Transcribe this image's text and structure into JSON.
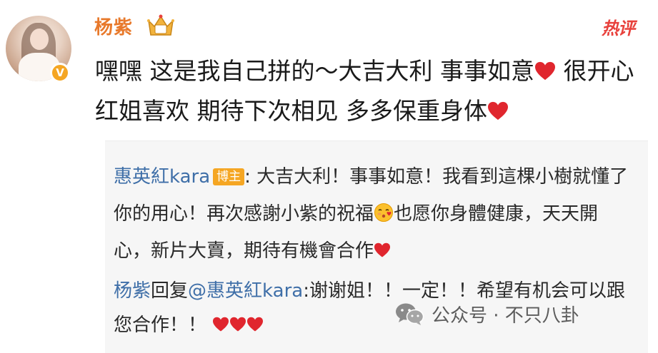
{
  "post": {
    "username": "杨紫",
    "hot_label": "热评",
    "content_parts": [
      "嘿嘿 这是我自己拼的～大吉大利 事事如意",
      " 很开心红姐喜欢 期待下次相见 多多保重身体"
    ]
  },
  "reply_author": {
    "name": "惠英紅kara",
    "badge": "博主",
    "text_part1": ": 大吉大利！事事如意！我看到這棵小樹就懂了你的用心！再次感謝小紫的祝福",
    "text_part2": "也愿你身體健康，天天開心，新片大賣，期待有機會合作"
  },
  "reply_user": {
    "name": "杨紫",
    "reply_word": "回复",
    "mention": "@惠英紅kara",
    "text": ":谢谢姐！！一定！！希望有机会可以跟您合作！！"
  },
  "watermark": {
    "text": "公众号 · 不只八卦",
    "icon": "wechat-icon"
  },
  "colors": {
    "username_orange": "#e8792b",
    "link_blue": "#3f6fa8",
    "hot_red": "#e8413c",
    "heart_red": "#e0262e",
    "badge_orange": "#f5a623",
    "panel_gray": "#f6f6f6"
  }
}
